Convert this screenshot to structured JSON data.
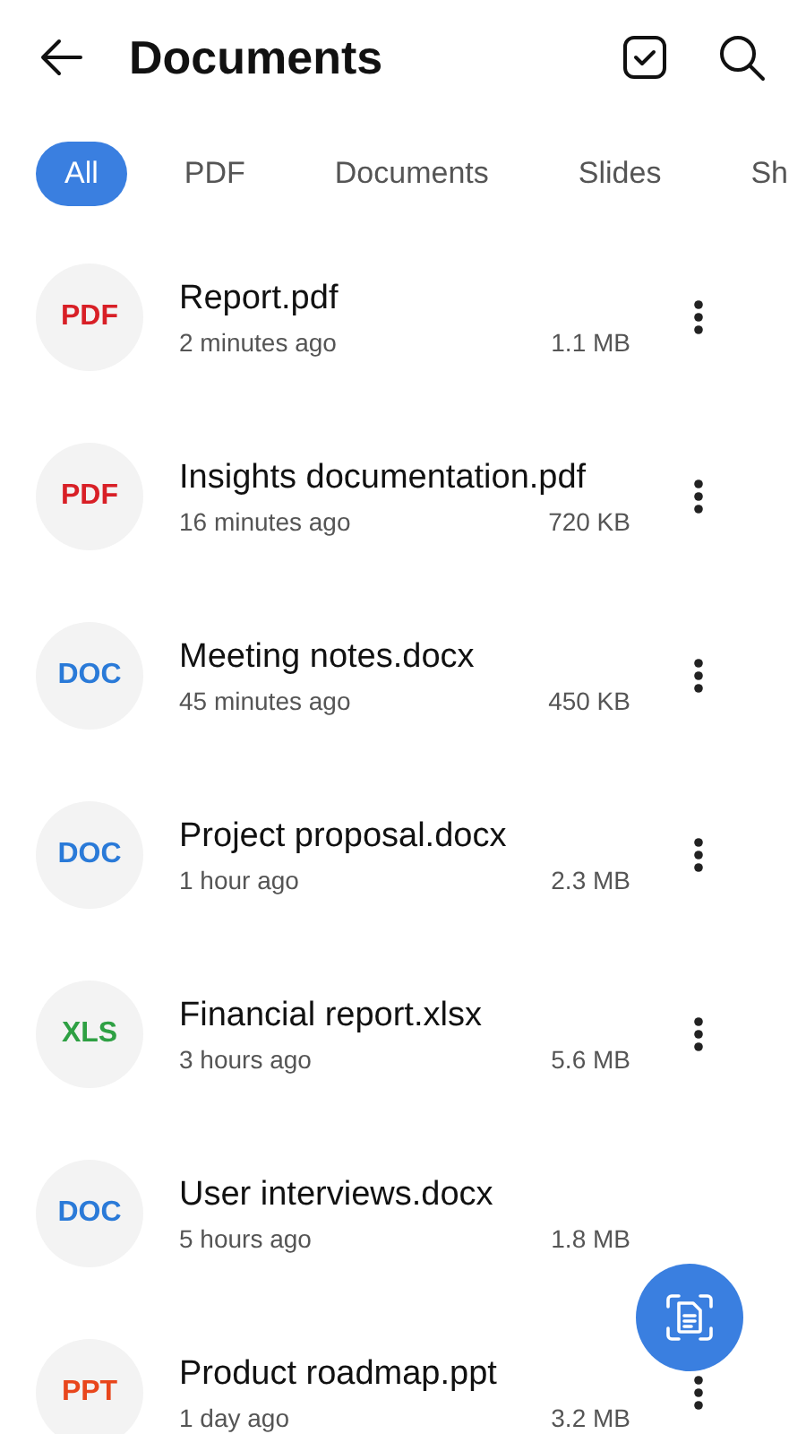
{
  "header": {
    "title": "Documents"
  },
  "tabs": [
    {
      "label": "All",
      "selected": true
    },
    {
      "label": "PDF",
      "selected": false
    },
    {
      "label": "Documents",
      "selected": false
    },
    {
      "label": "Slides",
      "selected": false
    },
    {
      "label": "Sh",
      "selected": false
    }
  ],
  "files": [
    {
      "kind": "pdf",
      "badge": "PDF",
      "name": "Report.pdf",
      "time": "2 minutes ago",
      "size": "1.1 MB",
      "more_button": true
    },
    {
      "kind": "pdf",
      "badge": "PDF",
      "name": "Insights documentation.pdf",
      "time": "16 minutes ago",
      "size": "720 KB",
      "more_button": true
    },
    {
      "kind": "doc",
      "badge": "DOC",
      "name": "Meeting notes.docx",
      "time": "45 minutes ago",
      "size": "450 KB",
      "more_button": true
    },
    {
      "kind": "doc",
      "badge": "DOC",
      "name": "Project proposal.docx",
      "time": "1 hour ago",
      "size": "2.3 MB",
      "more_button": true
    },
    {
      "kind": "xls",
      "badge": "XLS",
      "name": "Financial report.xlsx",
      "time": "3 hours ago",
      "size": "5.6 MB",
      "more_button": true
    },
    {
      "kind": "doc",
      "badge": "DOC",
      "name": "User interviews.docx",
      "time": "5 hours ago",
      "size": "1.8 MB",
      "more_button": false
    },
    {
      "kind": "ppt",
      "badge": "PPT",
      "name": "Product roadmap.ppt",
      "time": "1 day ago",
      "size": "3.2 MB",
      "more_button": true
    }
  ]
}
